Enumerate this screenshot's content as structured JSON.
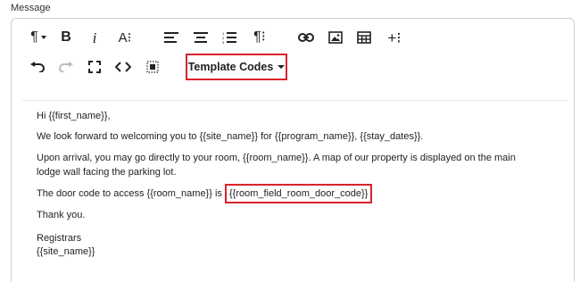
{
  "field_label": "Message",
  "toolbar": {
    "row1": [
      {
        "name": "paragraph-format-icon",
        "glyph": "¶▾"
      },
      {
        "name": "bold-icon",
        "glyph": "B"
      },
      {
        "name": "italic-icon",
        "glyph": "i"
      },
      {
        "name": "font-size-icon",
        "glyph": "A⁝"
      },
      {
        "name": "align-left-icon"
      },
      {
        "name": "align-center-icon"
      },
      {
        "name": "ordered-list-icon"
      },
      {
        "name": "paragraph-style-icon",
        "glyph": "¶⁝"
      },
      {
        "name": "link-icon"
      },
      {
        "name": "image-icon"
      },
      {
        "name": "table-icon"
      },
      {
        "name": "more-icon",
        "glyph": "+⁝"
      }
    ],
    "row2": [
      {
        "name": "undo-icon"
      },
      {
        "name": "redo-icon"
      },
      {
        "name": "fullscreen-icon"
      },
      {
        "name": "code-view-icon",
        "glyph": "<>"
      },
      {
        "name": "select-all-icon"
      }
    ],
    "template_codes_label": "Template Codes"
  },
  "message": {
    "greeting": "Hi {{first_name}},",
    "line1": "We look forward to welcoming you to {{site_name}} for {{program_name}}, {{stay_dates}}.",
    "line2": "Upon arrival, you may go directly to your room, {{room_name}}. A map of our property is displayed on the main lodge wall facing the parking lot.",
    "line3_prefix": "The door code to access {{room_name}} is ",
    "line3_code": "{{room_field_room_door_code}}",
    "thanks": "Thank you.",
    "signoff": "Registrars",
    "signature": "{{site_name}}"
  },
  "colors": {
    "highlight": "#d9232d"
  }
}
